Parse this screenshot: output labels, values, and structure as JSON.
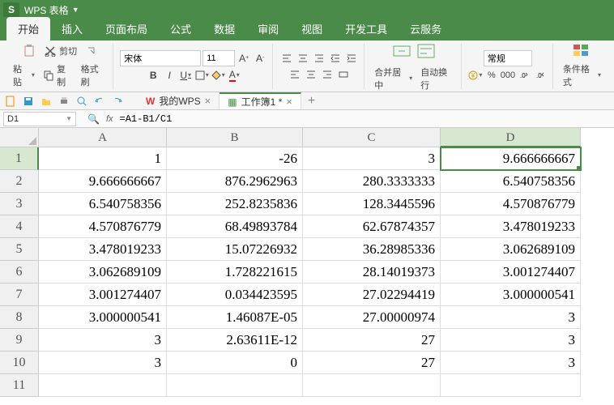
{
  "title_bar": {
    "logo": "S",
    "app_name": "WPS 表格"
  },
  "menu": {
    "tabs": [
      "开始",
      "插入",
      "页面布局",
      "公式",
      "数据",
      "审阅",
      "视图",
      "开发工具",
      "云服务"
    ],
    "active_index": 0
  },
  "ribbon": {
    "paste": "粘贴",
    "cut": "剪切",
    "copy": "复制",
    "format_painter": "格式刷",
    "font_name": "宋体",
    "font_size": "11",
    "merge_center": "合并居中",
    "wrap_text": "自动换行",
    "number_format": "常规",
    "conditional_fmt": "条件格式"
  },
  "doc_tabs": {
    "tab1": "我的WPS",
    "tab2": "工作簿1 *"
  },
  "formula_bar": {
    "cell_ref": "D1",
    "fx": "fx",
    "formula": "=A1-B1/C1"
  },
  "columns": [
    "A",
    "B",
    "C",
    "D"
  ],
  "rows": [
    "1",
    "2",
    "3",
    "4",
    "5",
    "6",
    "7",
    "8",
    "9",
    "10",
    "11"
  ],
  "cells": {
    "r1": {
      "A": "1",
      "B": "-26",
      "C": "3",
      "D": "9.666666667"
    },
    "r2": {
      "A": "9.666666667",
      "B": "876.2962963",
      "C": "280.3333333",
      "D": "6.540758356"
    },
    "r3": {
      "A": "6.540758356",
      "B": "252.8235836",
      "C": "128.3445596",
      "D": "4.570876779"
    },
    "r4": {
      "A": "4.570876779",
      "B": "68.49893784",
      "C": "62.67874357",
      "D": "3.478019233"
    },
    "r5": {
      "A": "3.478019233",
      "B": "15.07226932",
      "C": "36.28985336",
      "D": "3.062689109"
    },
    "r6": {
      "A": "3.062689109",
      "B": "1.728221615",
      "C": "28.14019373",
      "D": "3.001274407"
    },
    "r7": {
      "A": "3.001274407",
      "B": "0.034423595",
      "C": "27.02294419",
      "D": "3.000000541"
    },
    "r8": {
      "A": "3.000000541",
      "B": "1.46087E-05",
      "C": "27.00000974",
      "D": "3"
    },
    "r9": {
      "A": "3",
      "B": "2.63611E-12",
      "C": "27",
      "D": "3"
    },
    "r10": {
      "A": "3",
      "B": "0",
      "C": "27",
      "D": "3"
    },
    "r11": {
      "A": "",
      "B": "",
      "C": "",
      "D": ""
    }
  },
  "selected": {
    "row": 1,
    "col": "D"
  }
}
